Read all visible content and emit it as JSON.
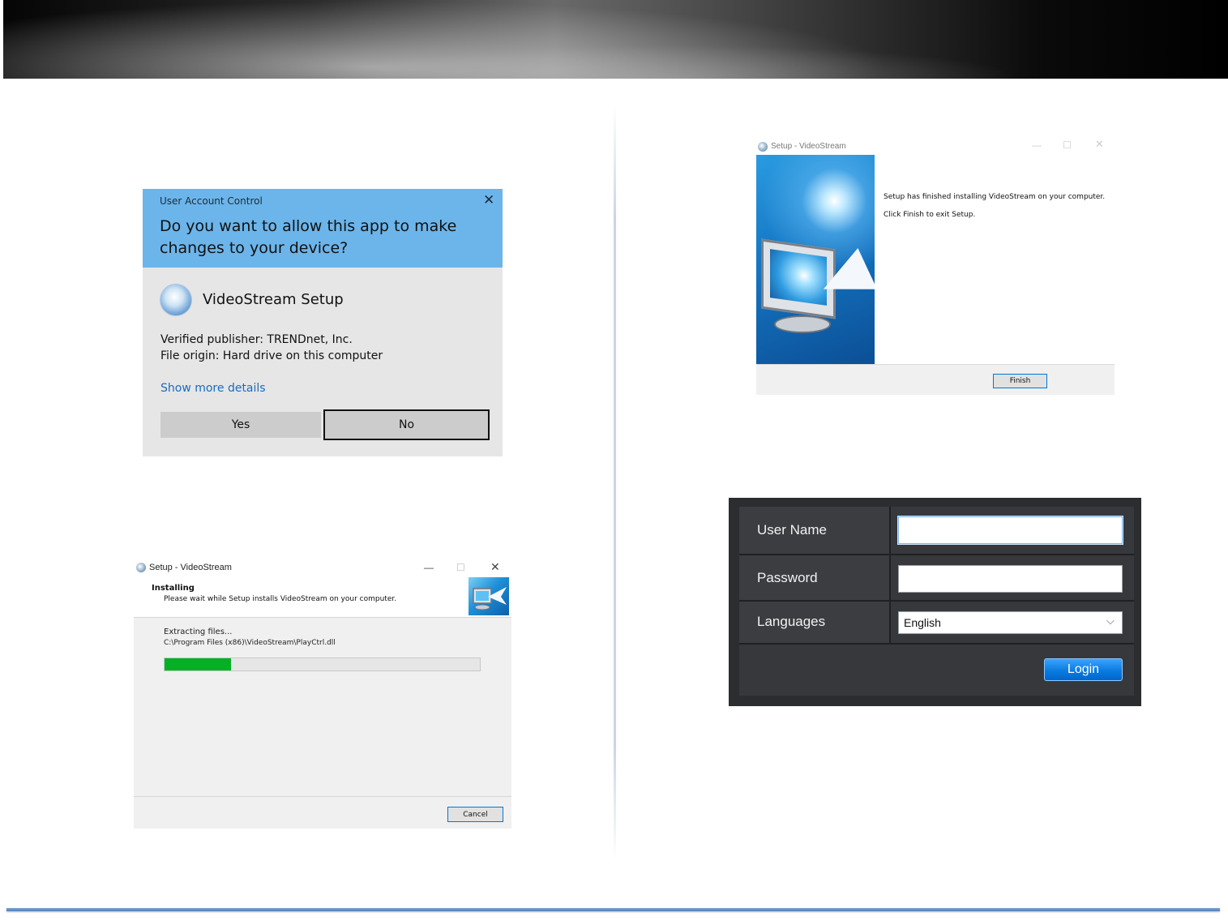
{
  "uac": {
    "title": "User Account Control",
    "close_glyph": "✕",
    "question": "Do you want to allow this app to make changes to your device?",
    "app_name": "VideoStream Setup",
    "publisher": "Verified publisher: TRENDnet, Inc.",
    "origin": "File origin: Hard drive on this computer",
    "details_link": "Show more details",
    "yes_label": "Yes",
    "no_label": "No"
  },
  "installer": {
    "title": "Setup - VideoStream",
    "min_glyph": "—",
    "max_glyph": "☐",
    "close_glyph": "✕",
    "heading": "Installing",
    "subheading": "Please wait while Setup installs VideoStream on your computer.",
    "status": "Extracting files...",
    "path": "C:\\Program Files (x86)\\VideoStream\\PlayCtrl.dll",
    "progress": 0.21,
    "cancel_label": "Cancel"
  },
  "finish": {
    "title": "Setup - VideoStream",
    "min_glyph": "—",
    "max_glyph": "☐",
    "close_glyph": "✕",
    "message1": "Setup has finished installing VideoStream on your computer.",
    "message2": "Click Finish to exit Setup.",
    "finish_label": "Finish"
  },
  "login": {
    "username_label": "User Name",
    "username_value": "",
    "password_label": "Password",
    "password_value": "",
    "languages_label": "Languages",
    "language_value": "English",
    "chevron_glyph": "⌵",
    "login_label": "Login"
  },
  "colors": {
    "uac_header": "#6cb5ea",
    "progress_fill": "#06b025",
    "login_button": "#0a7be0"
  }
}
